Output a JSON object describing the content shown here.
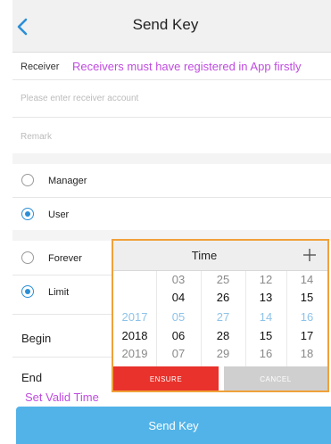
{
  "header": {
    "title": "Send Key",
    "back_icon": "chevron-left-icon"
  },
  "receiver": {
    "label": "Receiver",
    "hint": "Receivers must have registered in App firstly",
    "account_placeholder": "Please enter receiver account",
    "remark_placeholder": "Remark"
  },
  "role": {
    "options": [
      {
        "label": "Manager",
        "checked": false
      },
      {
        "label": "User",
        "checked": true
      }
    ]
  },
  "validity": {
    "options": [
      {
        "label": "Forever",
        "checked": false
      },
      {
        "label": "Limit",
        "checked": true
      }
    ],
    "begin_label": "Begin",
    "end_label": "End",
    "hint": "Set Valid Time"
  },
  "picker": {
    "title": "Time",
    "add_icon": "plus-icon",
    "columns": [
      [
        "",
        "",
        "2017",
        "2018",
        "2019"
      ],
      [
        "03",
        "04",
        "05",
        "06",
        "07"
      ],
      [
        "25",
        "26",
        "27",
        "28",
        "29"
      ],
      [
        "12",
        "13",
        "14",
        "15",
        "16"
      ],
      [
        "14",
        "15",
        "16",
        "17",
        "18"
      ]
    ],
    "ensure_label": "ENSURE",
    "cancel_label": "CANCEL"
  },
  "send_button": "Send Key",
  "colors": {
    "accent": "#2b8fd6",
    "hint": "#c04ce0",
    "ensure": "#e8322b",
    "send": "#52b3e8",
    "picker_border": "#f0a13a"
  }
}
